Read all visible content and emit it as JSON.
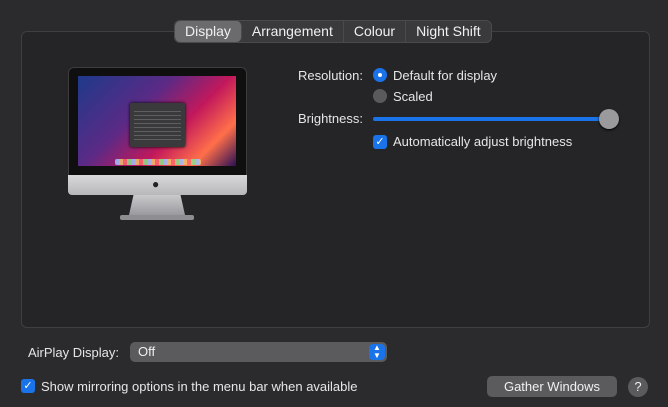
{
  "tabs": [
    {
      "label": "Display",
      "active": true
    },
    {
      "label": "Arrangement",
      "active": false
    },
    {
      "label": "Colour",
      "active": false
    },
    {
      "label": "Night Shift",
      "active": false
    }
  ],
  "resolution": {
    "label": "Resolution:",
    "options": [
      {
        "label": "Default for display",
        "selected": true
      },
      {
        "label": "Scaled",
        "selected": false
      }
    ]
  },
  "brightness": {
    "label": "Brightness:",
    "level": 1.0,
    "auto_adjust_label": "Automatically adjust brightness",
    "auto_adjust_checked": true
  },
  "airplay": {
    "label": "AirPlay Display:",
    "value": "Off"
  },
  "mirroring": {
    "label": "Show mirroring options in the menu bar when available",
    "checked": true
  },
  "gather_windows_label": "Gather Windows",
  "help_label": "?",
  "icons": {
    "monitor": "imac-icon",
    "apple": "apple-logo-icon",
    "check": "checkmark-icon",
    "stepper": "chevron-up-down-icon"
  },
  "colors": {
    "accent": "#1a73e8",
    "background": "#2b2b2d"
  }
}
